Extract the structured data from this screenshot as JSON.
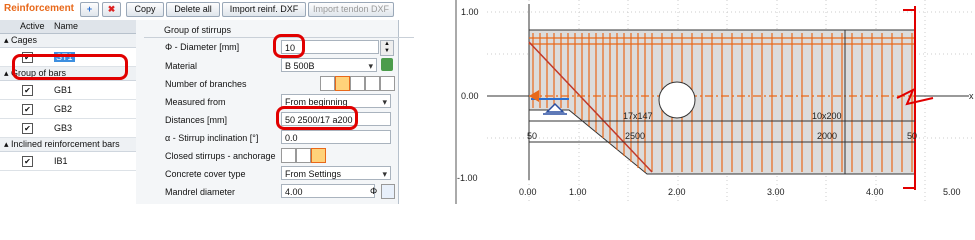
{
  "toolbar": {
    "title": "Reinforcement",
    "add_icon": "plus-icon",
    "delete_icon": "x-icon",
    "copy": "Copy",
    "delete_all": "Delete all",
    "import_reinf": "Import reinf. DXF",
    "import_tendon": "Import tendon DXF"
  },
  "tree": {
    "col_active": "Active",
    "col_name": "Name",
    "groups": [
      {
        "label": "Cages",
        "items": [
          {
            "name": "ST1",
            "checked": "✔"
          }
        ]
      },
      {
        "label": "Group of bars",
        "items": [
          {
            "name": "GB1",
            "checked": "✔"
          },
          {
            "name": "GB2",
            "checked": "✔"
          },
          {
            "name": "GB3",
            "checked": "✔"
          }
        ]
      },
      {
        "label": "Inclined reinforcement bars",
        "items": [
          {
            "name": "IB1",
            "checked": "✔"
          }
        ]
      }
    ]
  },
  "props": {
    "section": "Group of stirrups",
    "diameter_label": "Φ - Diameter [mm]",
    "diameter_value": "10",
    "material_label": "Material",
    "material_value": "B 500B",
    "branches_label": "Number of branches",
    "measured_label": "Measured from",
    "measured_value": "From beginning",
    "distances_label": "Distances [mm]",
    "distances_value": "50 2500/17 a200",
    "incl_label": "α - Stirrup inclination [°]",
    "incl_value": "0.0",
    "closed_label": "Closed stirrups - anchorage",
    "cover_label": "Concrete cover type",
    "cover_value": "From Settings",
    "mandrel_label": "Mandrel diameter",
    "mandrel_value": "4.00",
    "mandrel_unit": "Φ"
  },
  "drawing": {
    "y_ticks": [
      "1.00",
      "0.00",
      "-1.00"
    ],
    "x_ticks": [
      "0.00",
      "1.00",
      "2.00",
      "3.00",
      "4.00",
      "5.00"
    ],
    "axis_x": "x",
    "spacing_a": "17x147",
    "spacing_b": "10x200",
    "dim_left": "50",
    "dim_2500": "2500",
    "dim_2000": "2000",
    "dim_right": "50",
    "colors": {
      "stirrup": "#e8681a",
      "section_line": "#e10000",
      "concrete": "#dcdcdc"
    }
  }
}
